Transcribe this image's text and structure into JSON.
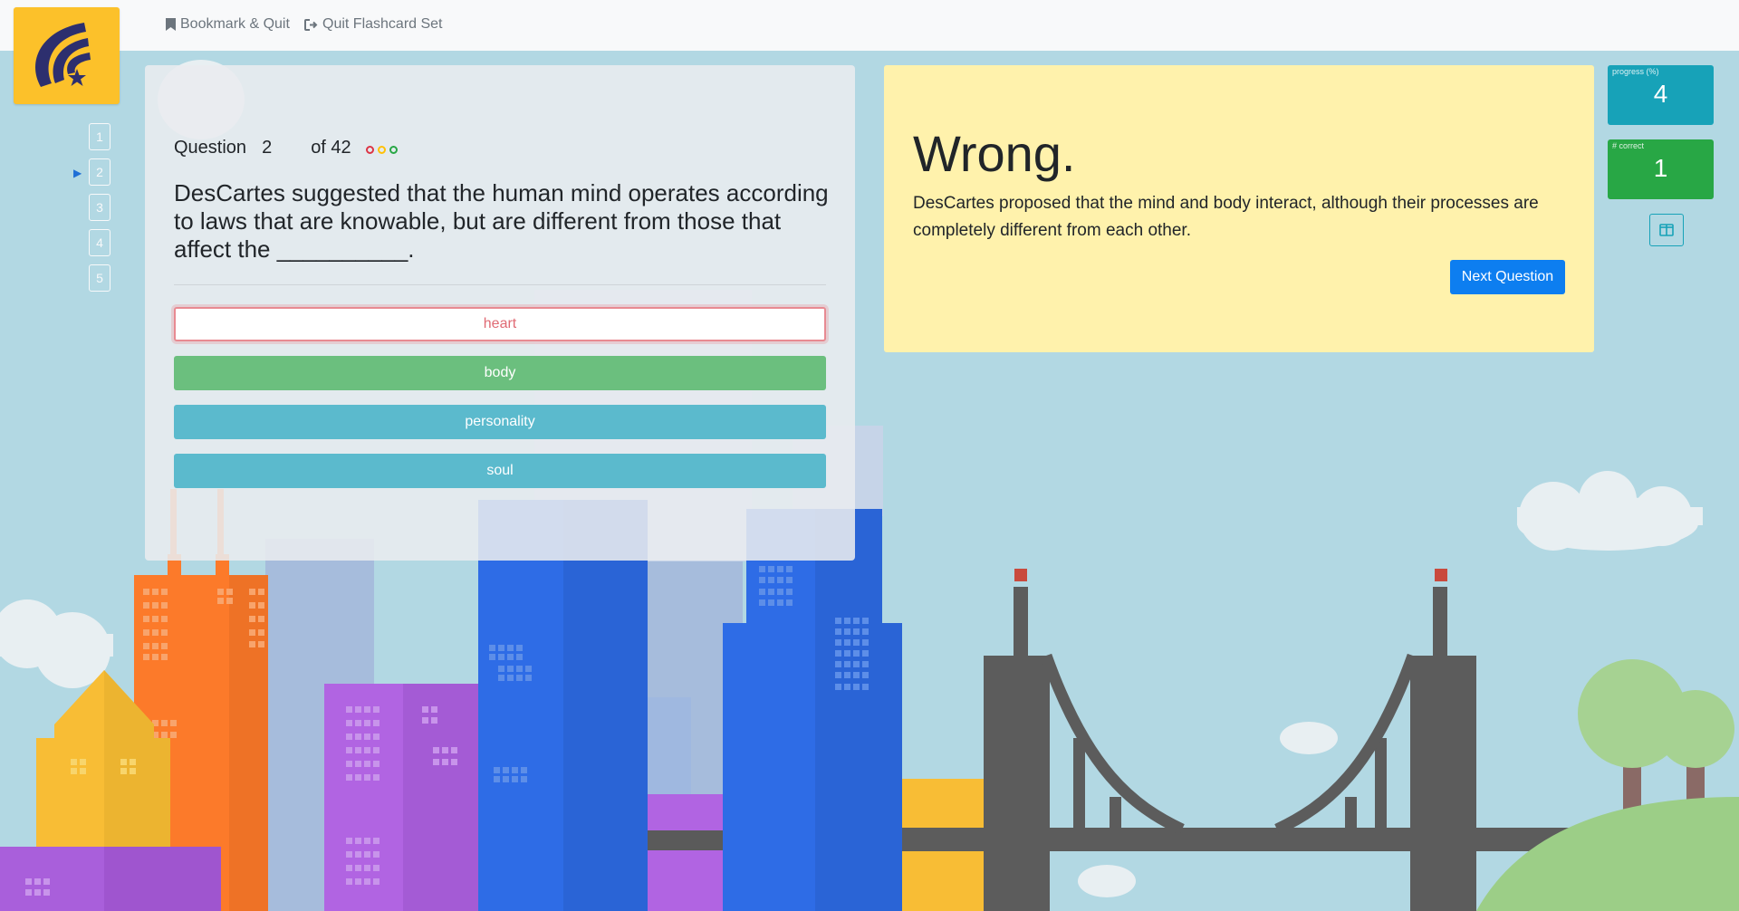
{
  "nav": {
    "bookmark_label": "Bookmark & Quit",
    "quit_label": "Quit Flashcard Set"
  },
  "question_nav": {
    "items": [
      "1",
      "2",
      "3",
      "4",
      "5"
    ],
    "current": "2"
  },
  "question": {
    "label": "Question",
    "number": "2",
    "of_total": "of 42",
    "text": "DesCartes suggested that the human mind operates according to laws that are knowable, but are different from those that affect the __________.",
    "indicator_colors": [
      "#dc3545",
      "#ffc107",
      "#28a745"
    ],
    "answers": [
      {
        "label": "heart",
        "state": "wrong"
      },
      {
        "label": "body",
        "state": "correct"
      },
      {
        "label": "personality",
        "state": "other"
      },
      {
        "label": "soul",
        "state": "other"
      }
    ]
  },
  "feedback": {
    "title": "Wrong.",
    "body": "DesCartes proposed that the mind and body interact, although their processes are completely different from each other.",
    "next_label": "Next Question"
  },
  "stats": {
    "progress_label": "progress (%)",
    "progress_value": "4",
    "correct_label": "# correct",
    "correct_value": "1"
  },
  "colors": {
    "logo_bg": "#fcc12a",
    "logo_mark": "#2d2f6e",
    "progress": "#17a2b8",
    "correct": "#28a745",
    "feedback_bg": "#fff2ac",
    "primary": "#0d7ef0"
  }
}
